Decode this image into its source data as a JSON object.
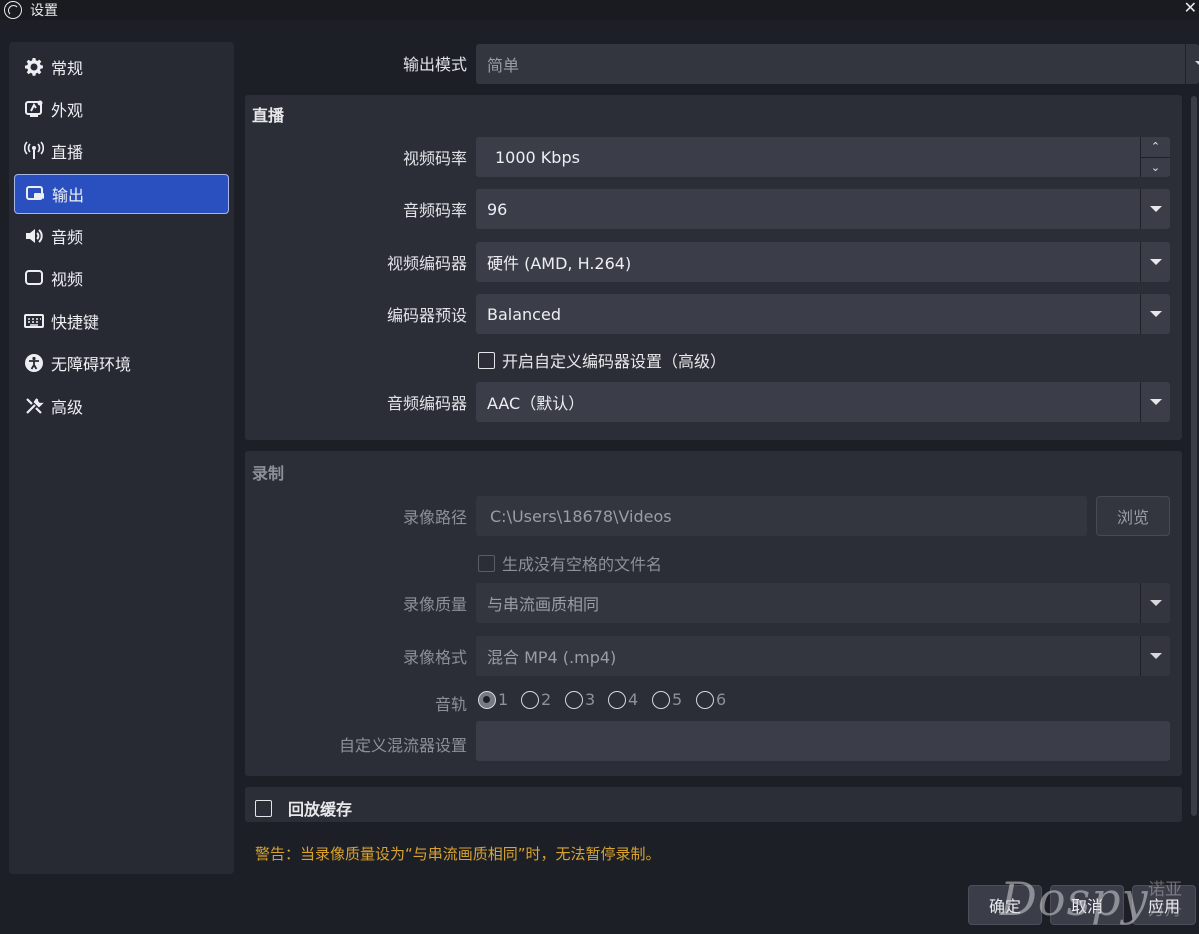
{
  "window": {
    "title": "设置"
  },
  "sidebar": {
    "items": [
      {
        "label": "常规",
        "icon": "gear-icon",
        "active": false
      },
      {
        "label": "外观",
        "icon": "appearance-icon",
        "active": false
      },
      {
        "label": "直播",
        "icon": "antenna-icon",
        "active": false
      },
      {
        "label": "输出",
        "icon": "output-icon",
        "active": true
      },
      {
        "label": "音频",
        "icon": "speaker-icon",
        "active": false
      },
      {
        "label": "视频",
        "icon": "monitor-icon",
        "active": false
      },
      {
        "label": "快捷键",
        "icon": "keyboard-icon",
        "active": false
      },
      {
        "label": "无障碍环境",
        "icon": "accessibility-icon",
        "active": false
      },
      {
        "label": "高级",
        "icon": "tools-icon",
        "active": false
      }
    ]
  },
  "output_mode": {
    "label": "输出模式",
    "value": "简单"
  },
  "streaming": {
    "title": "直播",
    "video_bitrate": {
      "label": "视频码率",
      "value": "1000 Kbps"
    },
    "audio_bitrate": {
      "label": "音频码率",
      "value": "96"
    },
    "video_encoder": {
      "label": "视频编码器",
      "value": "硬件 (AMD, H.264)"
    },
    "encoder_preset": {
      "label": "编码器预设",
      "value": "Balanced"
    },
    "custom_encoder_checkbox": {
      "label": "开启自定义编码器设置（高级）",
      "checked": false
    },
    "audio_encoder": {
      "label": "音频编码器",
      "value": "AAC（默认）"
    }
  },
  "recording": {
    "title": "录制",
    "path": {
      "label": "录像路径",
      "value": "C:\\Users\\18678\\Videos",
      "browse_label": "浏览"
    },
    "no_space_checkbox": {
      "label": "生成没有空格的文件名",
      "checked": false
    },
    "quality": {
      "label": "录像质量",
      "value": "与串流画质相同"
    },
    "format": {
      "label": "录像格式",
      "value": "混合 MP4 (.mp4)"
    },
    "tracks": {
      "label": "音轨",
      "options": [
        "1",
        "2",
        "3",
        "4",
        "5",
        "6"
      ],
      "selected": "1"
    },
    "custom_muxer": {
      "label": "自定义混流器设置",
      "value": ""
    }
  },
  "replay_buffer": {
    "label": "回放缓存",
    "checked": false
  },
  "warning": "警告：当录像质量设为“与串流画质相同”时，无法暂停录制。",
  "buttons": {
    "ok": "确定",
    "cancel": "取消",
    "apply": "应用"
  },
  "watermark": {
    "text": "Dospy",
    "sub": "诺亚方舟"
  },
  "colors": {
    "accent": "#2a50c0",
    "warning": "#d8a331",
    "background": "#1d1f26",
    "panel": "#2b2e37"
  }
}
